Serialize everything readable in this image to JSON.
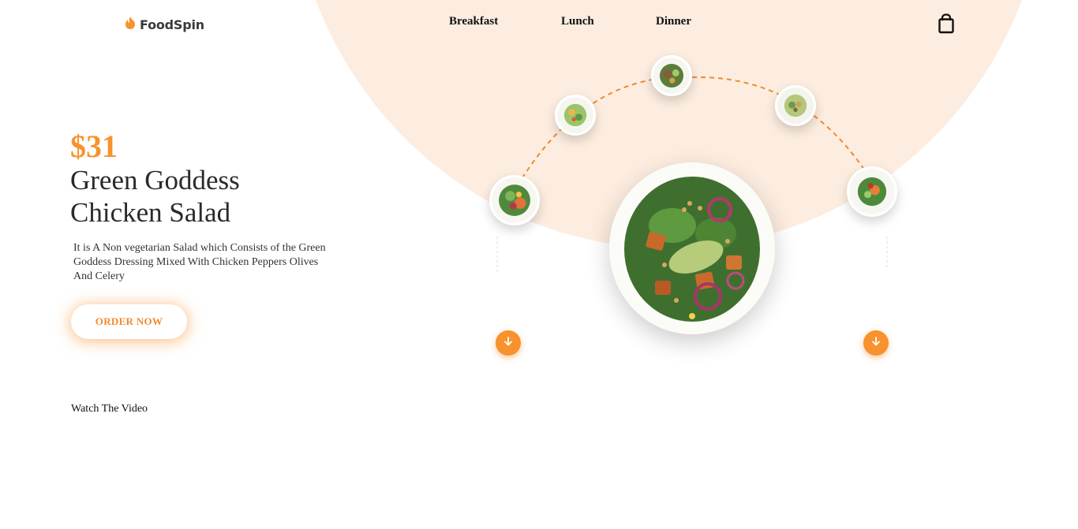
{
  "brand": {
    "name": "FoodSpin",
    "icon": "flame-icon"
  },
  "nav": {
    "items": [
      "Breakfast",
      "Lunch",
      "Dinner"
    ]
  },
  "header": {
    "cart_icon": "shopping-bag-icon"
  },
  "hero": {
    "price": "$31",
    "title_line1": "Green Goddess",
    "title_line2": "Chicken Salad",
    "description": "It is A Non vegetarian Salad which Consists of the Green Goddess Dressing Mixed With Chicken Peppers Olives And Celery",
    "order_button": "ORDER NOW",
    "watch_video": "Watch The Video"
  },
  "carousel": {
    "prev_icon": "arrow-down-icon",
    "next_icon": "arrow-down-icon"
  },
  "colors": {
    "accent": "#f7922e",
    "background_shape": "#fdede0"
  }
}
